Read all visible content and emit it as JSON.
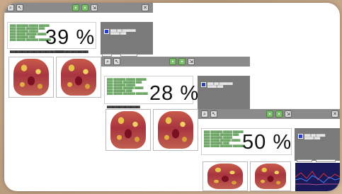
{
  "panels": [
    {
      "percent": "39 %"
    },
    {
      "percent": "28 %"
    },
    {
      "percent": "50 %"
    }
  ],
  "colors": {
    "log_text": "#6aa564",
    "checkbox": "#2c3fd0",
    "toolbar": "#8a8a8a"
  },
  "icons": {
    "zoom": "search-icon",
    "tool": "cursor-icon",
    "nav_prev": "green-button",
    "nav_next": "green-button",
    "nav_export": "export-icon",
    "close": "close-icon"
  }
}
